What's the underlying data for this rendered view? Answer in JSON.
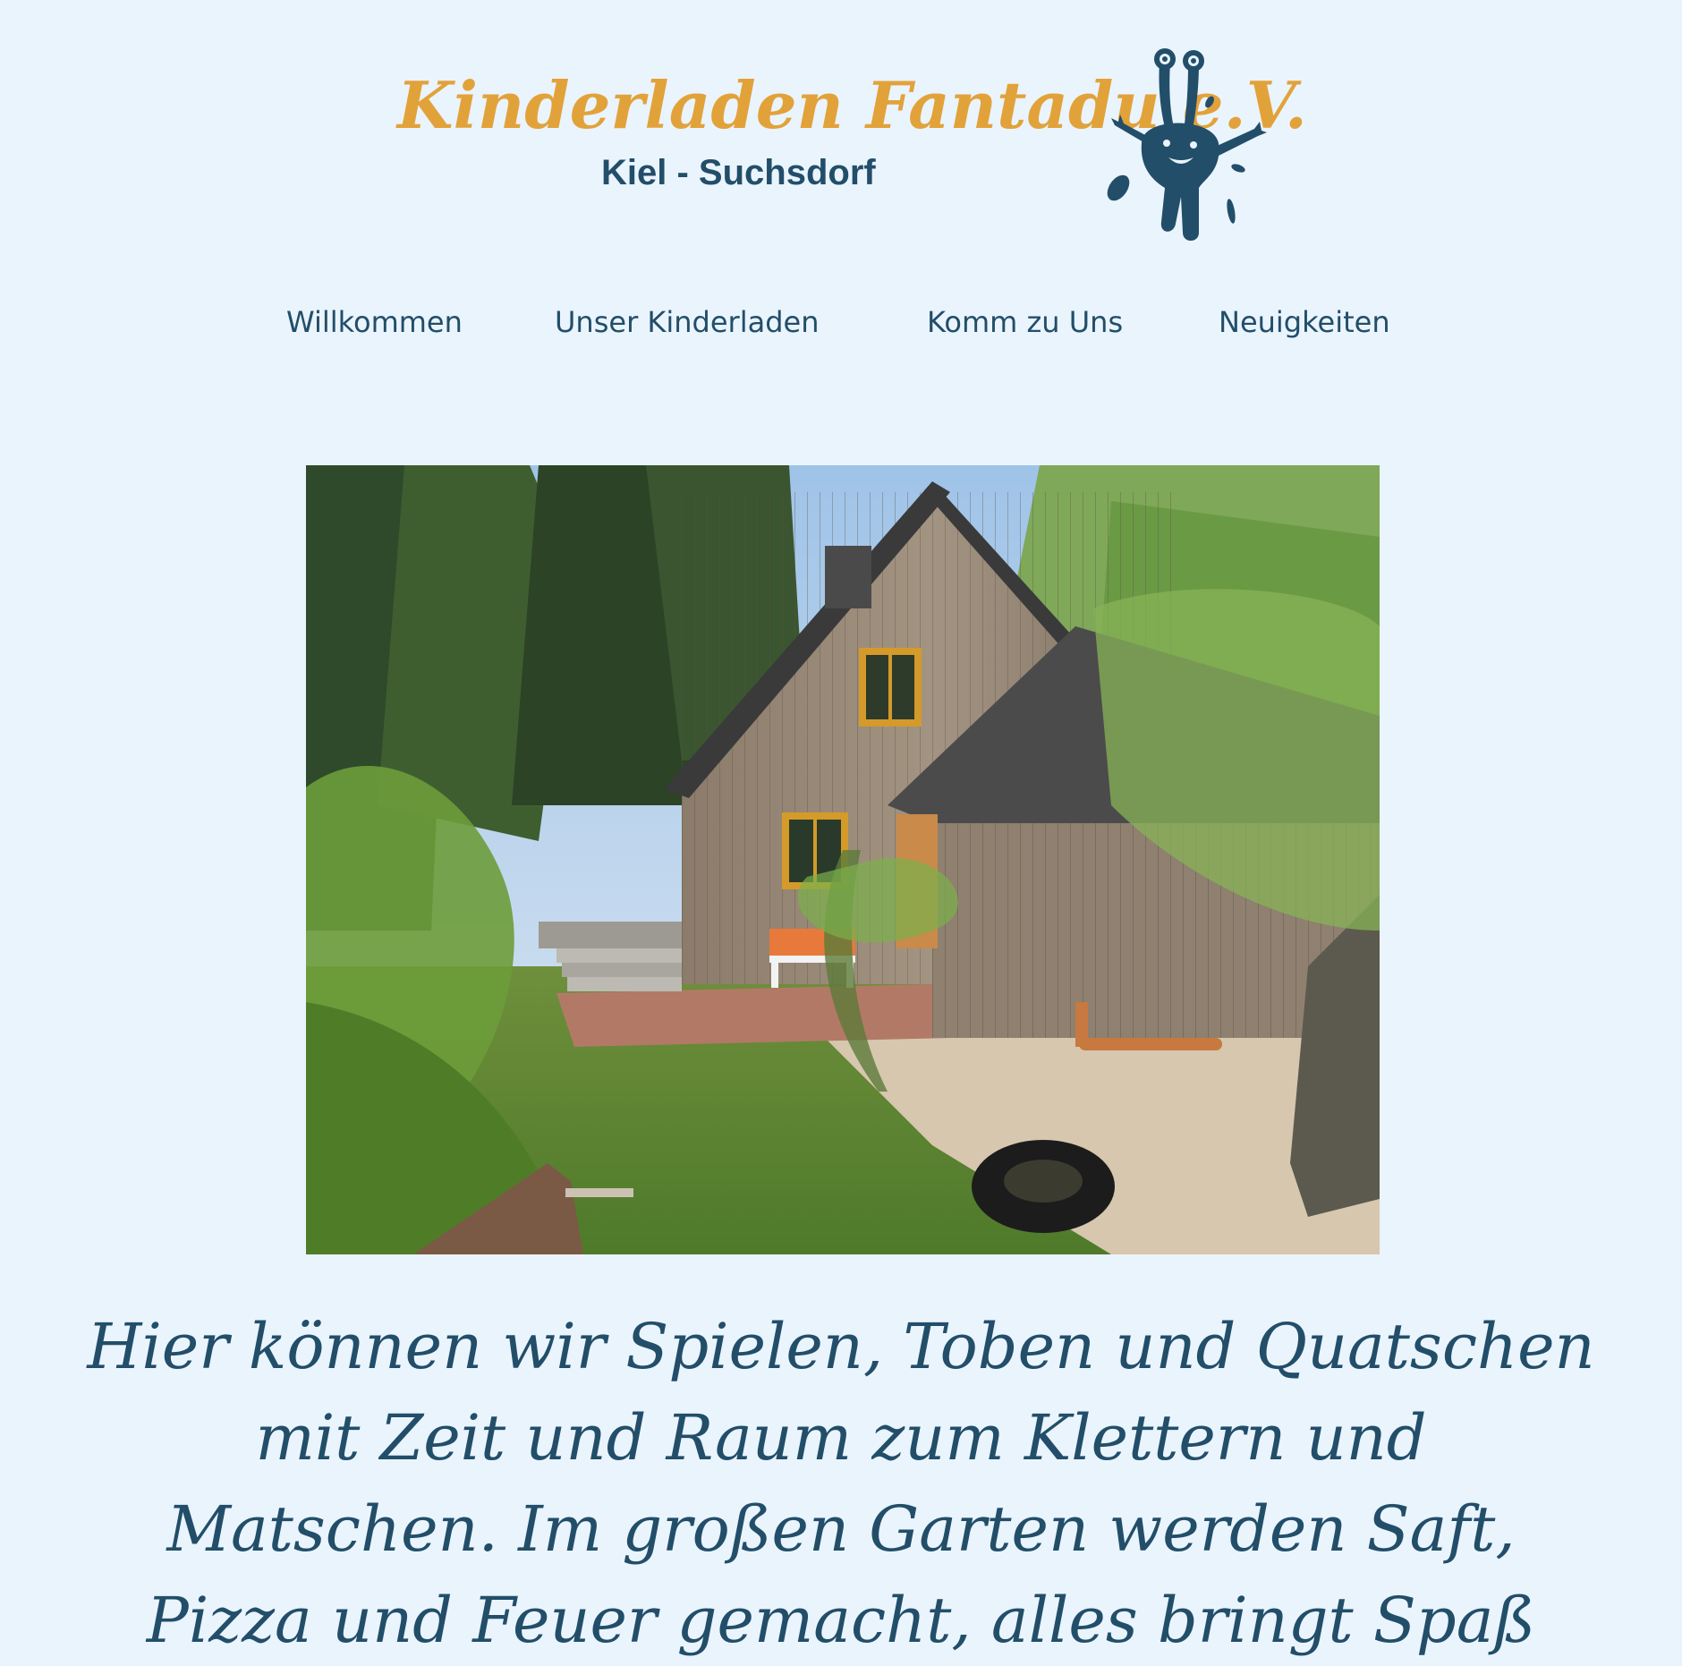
{
  "header": {
    "logo_title": "Kinderladen Fantadu e.V.",
    "logo_subtitle": "Kiel - Suchsdorf",
    "mascot_icon": "blue-splash-mascot-icon"
  },
  "nav": {
    "items": [
      {
        "label": "Willkommen"
      },
      {
        "label": "Unser Kinderladen"
      },
      {
        "label": "Komm zu Uns"
      },
      {
        "label": "Neuigkeiten"
      }
    ]
  },
  "hero": {
    "image": "photo-wooden-house-garden"
  },
  "main": {
    "tagline": "Hier können wir Spielen, Toben und Quatschen mit Zeit und Raum zum Klettern und Matschen. Im großen Garten werden Saft, Pizza und Feuer gemacht, alles bringt Spaß"
  },
  "colors": {
    "background": "#eaf4fd",
    "brand_orange": "#e2a23a",
    "brand_blue": "#224e69"
  }
}
